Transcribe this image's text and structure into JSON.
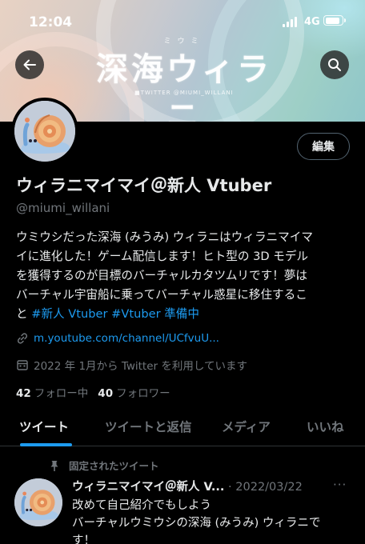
{
  "status_bar": {
    "time": "12:04",
    "network": "4G"
  },
  "banner": {
    "logo_text": "深海ウィラニ",
    "logo_sub": "ミウミ",
    "twitter_text": "■TWITTER  @MIUMI_WILLANI"
  },
  "profile": {
    "display_name": "ウィラニマイマイ＠新人 Vtuber",
    "handle": "@miumi_willani",
    "edit_label": "編集",
    "bio_lines": [
      "ウミウシだった深海 (みうみ) ウィラニはウィラニマイマ",
      "イに進化した！ゲーム配信します！ヒト型の 3D モデル",
      "を獲得するのが目標のバーチャルカタツムリです！夢は",
      "バーチャル宇宙船に乗ってバーチャル惑星に移住するこ"
    ],
    "bio_last_prefix": "と ",
    "bio_hashtags": [
      "#新人 Vtuber",
      "#Vtuber 準備中"
    ],
    "link": "m.youtube.com/channel/UCfvuU...",
    "joined": "2022 年 1月から Twitter を利用しています",
    "following_count": "42",
    "following_label": "フォロー中",
    "followers_count": "40",
    "followers_label": "フォロワー"
  },
  "tabs": [
    {
      "label": "ツイート",
      "active": true
    },
    {
      "label": "ツイートと返信",
      "active": false
    },
    {
      "label": "メディア",
      "active": false
    },
    {
      "label": "いいね",
      "active": false
    }
  ],
  "pinned_tweet": {
    "pinned_label": "固定されたツイート",
    "name": "ウィラニマイマイ＠新人 V...",
    "date": "· 2022/03/22",
    "more": "···",
    "lines": [
      "改めて自己紹介でもしよう",
      "バーチャルウミウシの深海 (みうみ) ウィラニで",
      "す！"
    ]
  },
  "colors": {
    "accent": "#1d9bf0",
    "muted": "#71767b",
    "text": "#e7e9ea",
    "background": "#000000"
  }
}
